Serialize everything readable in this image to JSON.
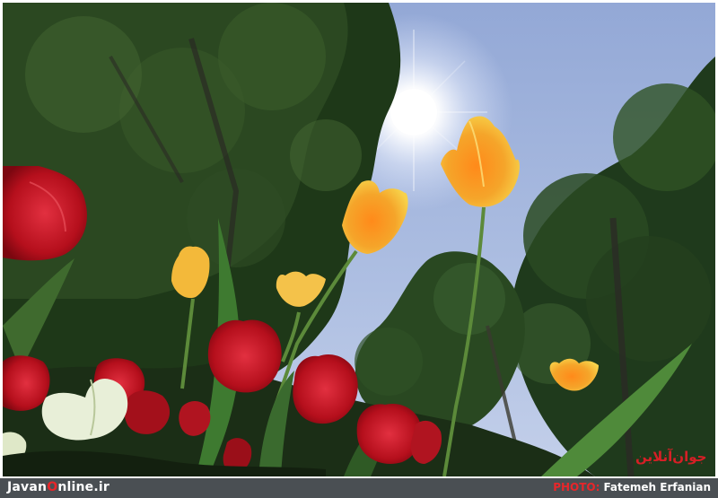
{
  "footer": {
    "site_prefix": "Javan",
    "site_letter": "O",
    "site_suffix": "nline.ir",
    "credit_label": "PHOTO:",
    "credit_name": "Fatemeh Erfanian"
  },
  "watermark": "جوان‌آنلاین",
  "colors": {
    "footer_bar": "#4a4f53",
    "brand_red": "#e8262a",
    "sky": "#a3b6dd",
    "tulip_red": "#c8101c",
    "tulip_yellow": "#f5b52e"
  }
}
